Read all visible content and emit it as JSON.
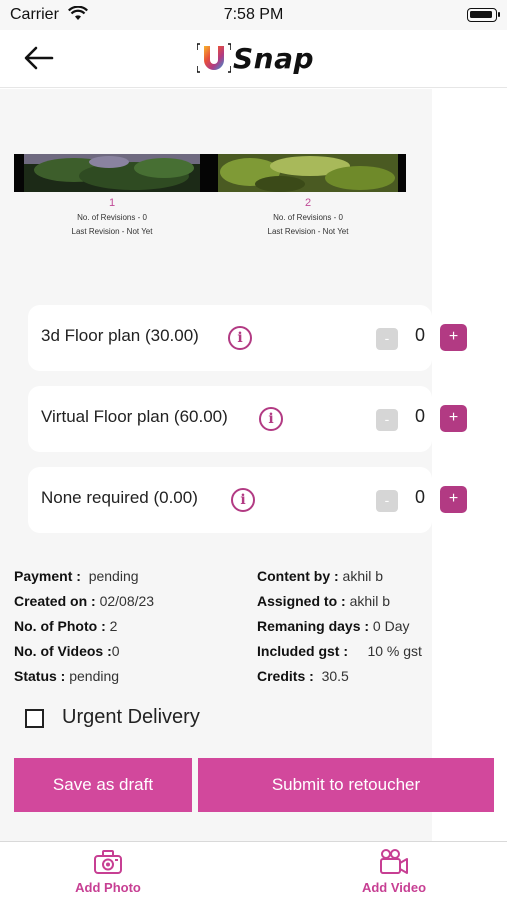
{
  "status_bar": {
    "carrier": "Carrier",
    "time": "7:58 PM"
  },
  "header": {
    "logo_letter": "U",
    "logo_text": "Snap"
  },
  "photos": [
    {
      "number": "1",
      "revisions": "No. of Revisions - 0",
      "last_revision": "Last Revision - Not Yet"
    },
    {
      "number": "2",
      "revisions": "No. of Revisions - 0",
      "last_revision": "Last Revision - Not Yet"
    }
  ],
  "services": [
    {
      "label": "3d Floor plan (30.00)",
      "qty": "0"
    },
    {
      "label": "Virtual Floor plan (60.00)",
      "qty": "0"
    },
    {
      "label": "None required (0.00)",
      "qty": "0"
    }
  ],
  "buttons": {
    "minus": "-",
    "plus": "+",
    "info": "i"
  },
  "details_left": [
    {
      "key": "Payment :",
      "value": "pending"
    },
    {
      "key": "Created on :",
      "value": "02/08/23"
    },
    {
      "key": "No. of Photo :",
      "value": "2"
    },
    {
      "key": "No. of Videos :",
      "value": "0"
    },
    {
      "key": "Status :",
      "value": "pending"
    }
  ],
  "details_right": [
    {
      "key": "Content by :",
      "value": "akhil  b"
    },
    {
      "key": "Assigned to :",
      "value": "akhil  b"
    },
    {
      "key": "Remaning days :",
      "value": "0 Day"
    },
    {
      "key": "Included gst :",
      "value": "10 % gst"
    },
    {
      "key": "Credits :",
      "value": "30.5"
    }
  ],
  "urgent": {
    "label": "Urgent Delivery",
    "checked": false
  },
  "actions": {
    "save_draft": "Save as draft",
    "submit": "Submit to retoucher"
  },
  "tabs": {
    "add_photo": "Add Photo",
    "add_video": "Add Video"
  },
  "colors": {
    "brand": "#b23a83",
    "button": "#d2489c",
    "tab_label": "#c73f93"
  }
}
